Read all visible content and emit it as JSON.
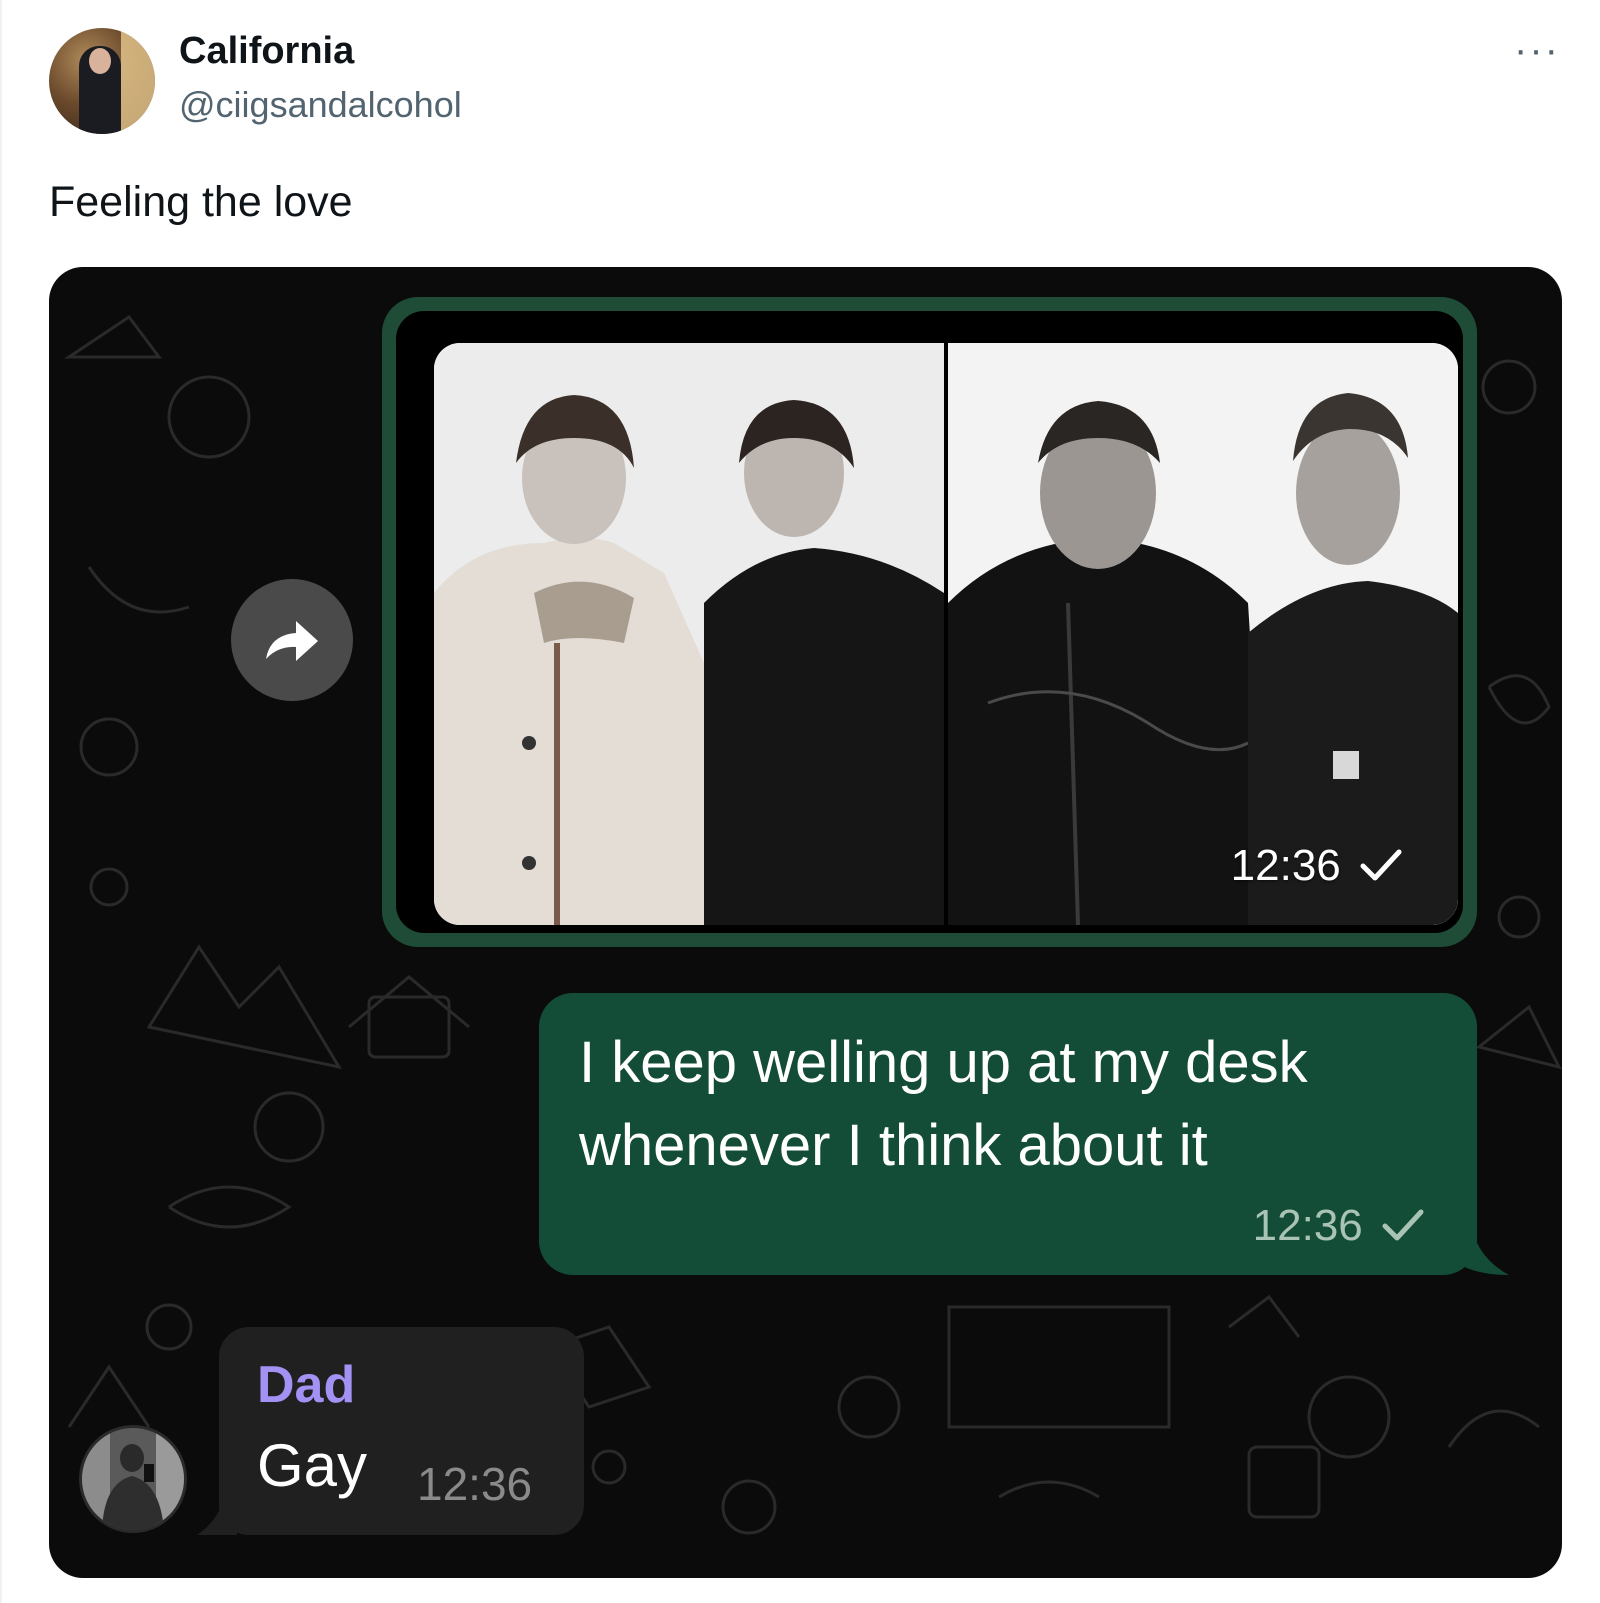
{
  "post": {
    "author_name": "California",
    "author_handle": "@ciigsandalcohol",
    "more_label": "···",
    "text": "Feeling the love"
  },
  "chat": {
    "image_message": {
      "time": "12:36",
      "status_icon": "check-icon"
    },
    "outgoing_message": {
      "line1": "I keep welling up at my desk",
      "line2": "whenever I think about it",
      "time": "12:36",
      "status_icon": "check-icon"
    },
    "incoming_message": {
      "sender": "Dad",
      "text": "Gay",
      "time": "12:36"
    },
    "forward_icon": "forward-arrow-icon"
  },
  "colors": {
    "outgoing_bubble": "#144d37",
    "image_bubble_border": "#1e4c36",
    "incoming_bubble": "#202020",
    "sender_name": "#a391f4",
    "chat_background": "#0b0b0b"
  }
}
